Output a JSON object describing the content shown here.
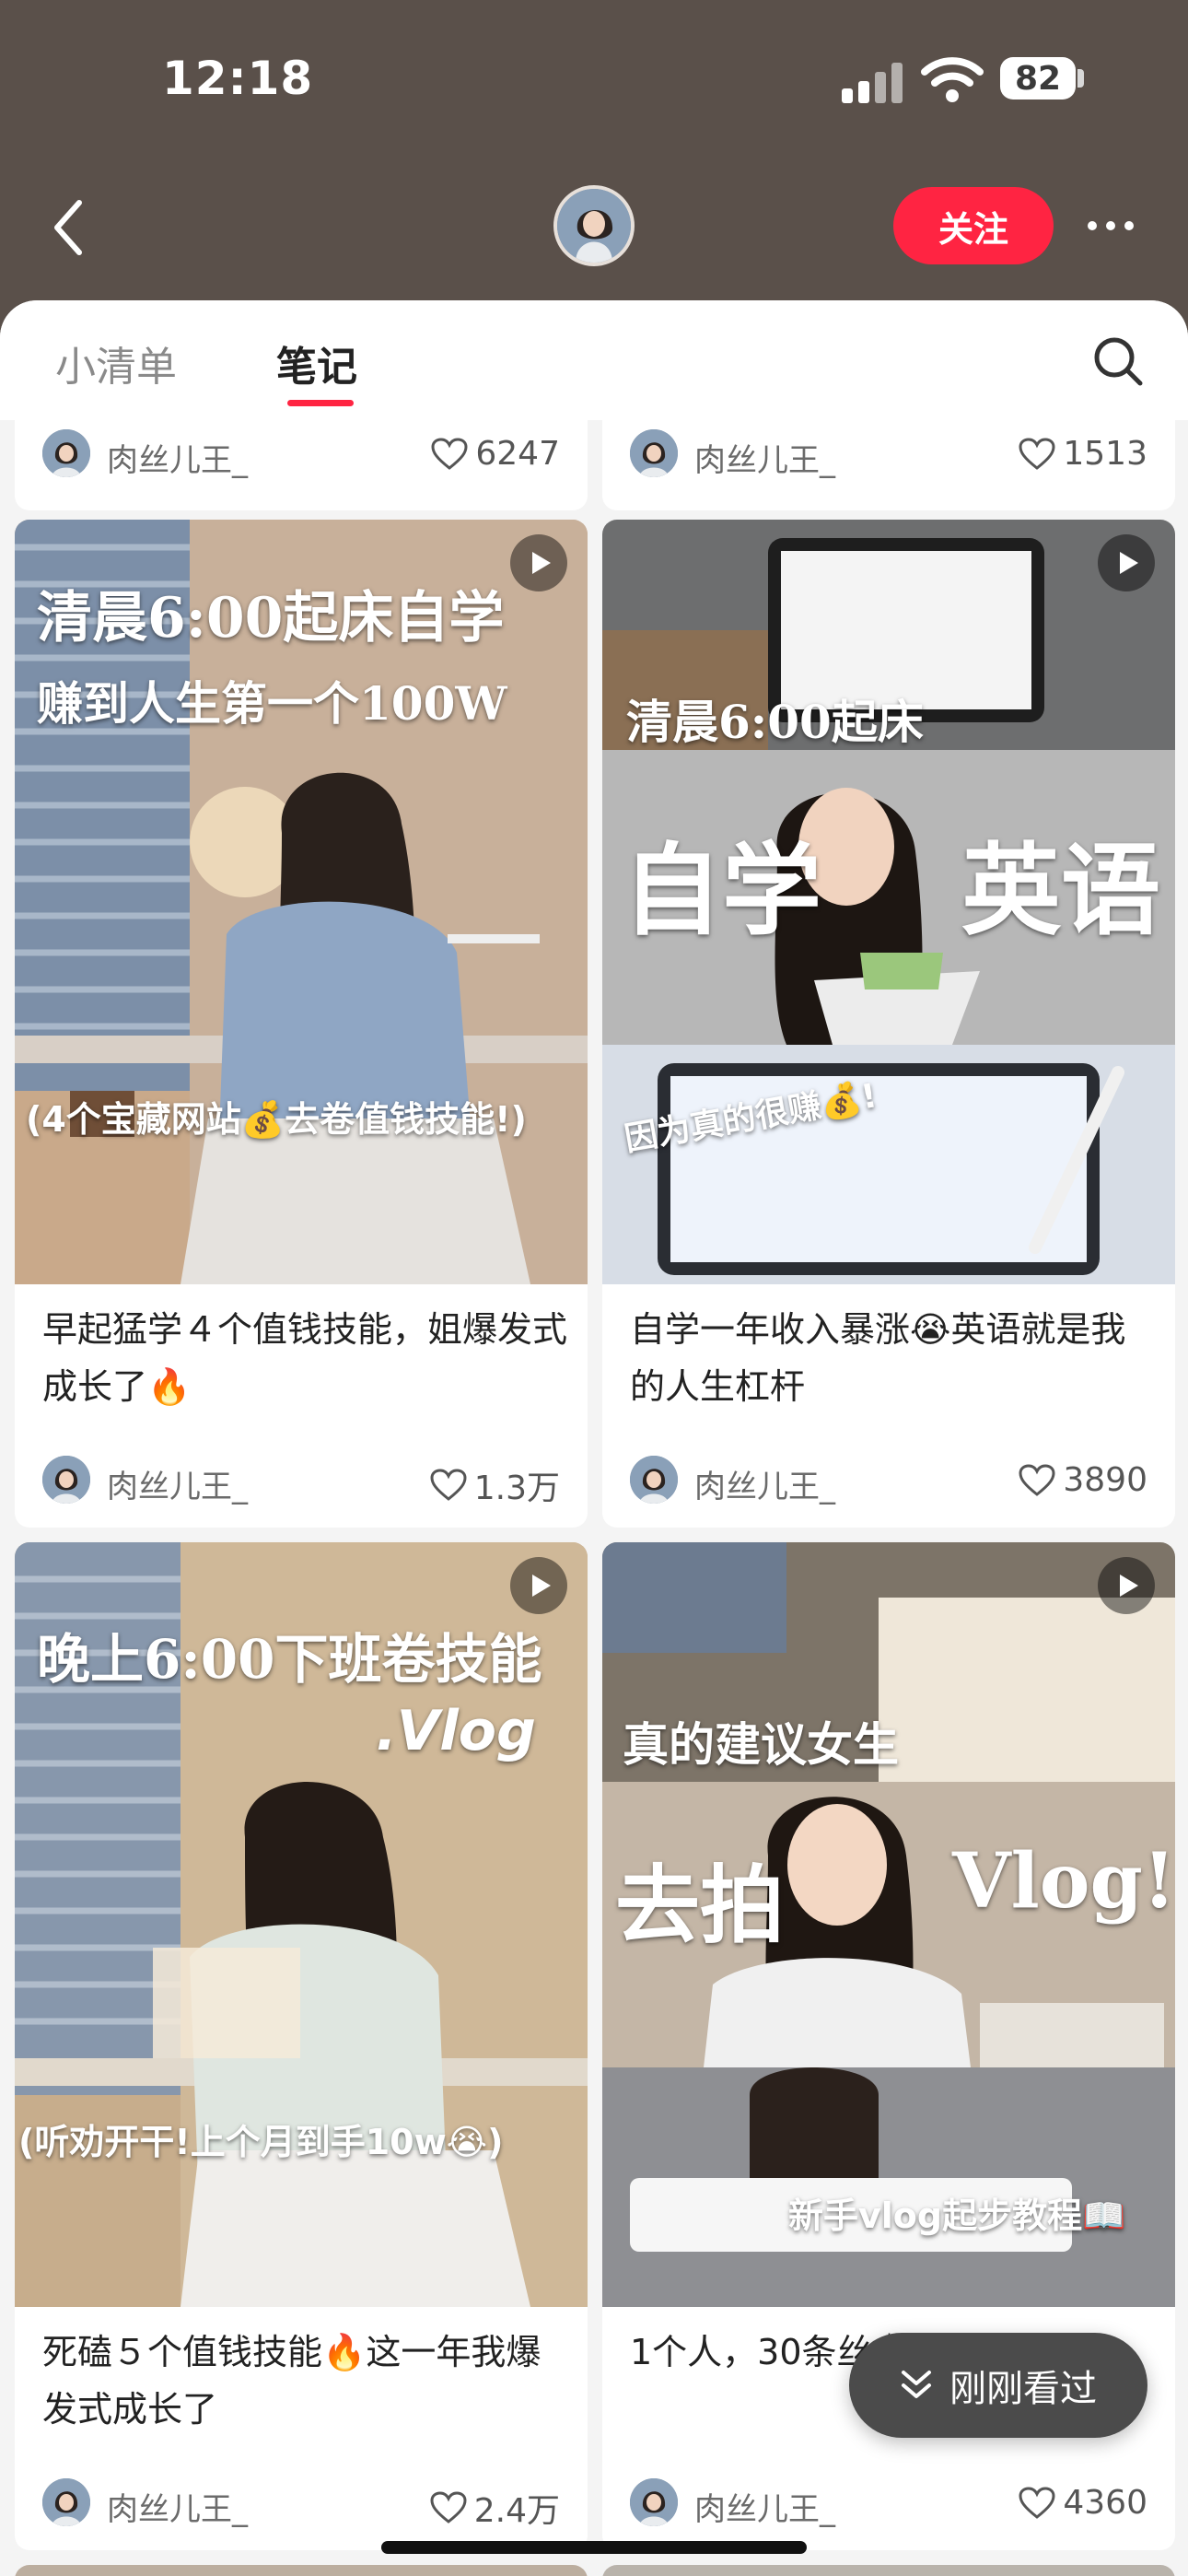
{
  "status_bar": {
    "time": "12:18",
    "battery": "82"
  },
  "profile_header": {
    "follow_label": "关注"
  },
  "tabs": {
    "list_label": "小清单",
    "notes_label": "笔记"
  },
  "cards": [
    {
      "author": "肉丝儿王_",
      "likes": "6247"
    },
    {
      "author": "肉丝儿王_",
      "likes": "1513"
    },
    {
      "overlay": [
        "清晨6:00起床自学",
        "赚到人生第一个100W",
        "(4个宝藏网站💰去卷值钱技能!)"
      ],
      "title": "早起猛学４个值钱技能，姐爆发式成长了🔥",
      "author": "肉丝儿王_",
      "likes": "1.3万"
    },
    {
      "overlay": [
        "清晨6:00起床",
        "自学",
        "英语",
        "因为真的很赚💰!"
      ],
      "title": "自学一年收入暴涨😭英语就是我的人生杠杆",
      "author": "肉丝儿王_",
      "likes": "3890"
    },
    {
      "overlay": [
        "晚上6:00下班卷技能",
        ".Vlog",
        "(听劝开干!上个月到手10w😭)"
      ],
      "title": "死磕５个值钱技能🔥这一年我爆发式成长了",
      "author": "肉丝儿王_",
      "likes": "2.4万"
    },
    {
      "overlay": [
        "真的建议女生",
        "去拍",
        "Vlog!",
        "新手vlog起步教程📖"
      ],
      "title": "1个人，30条丝｜ Vlog干货",
      "author": "肉丝儿王_",
      "likes": "4360"
    }
  ],
  "recent_view": {
    "label": "刚刚看过"
  }
}
